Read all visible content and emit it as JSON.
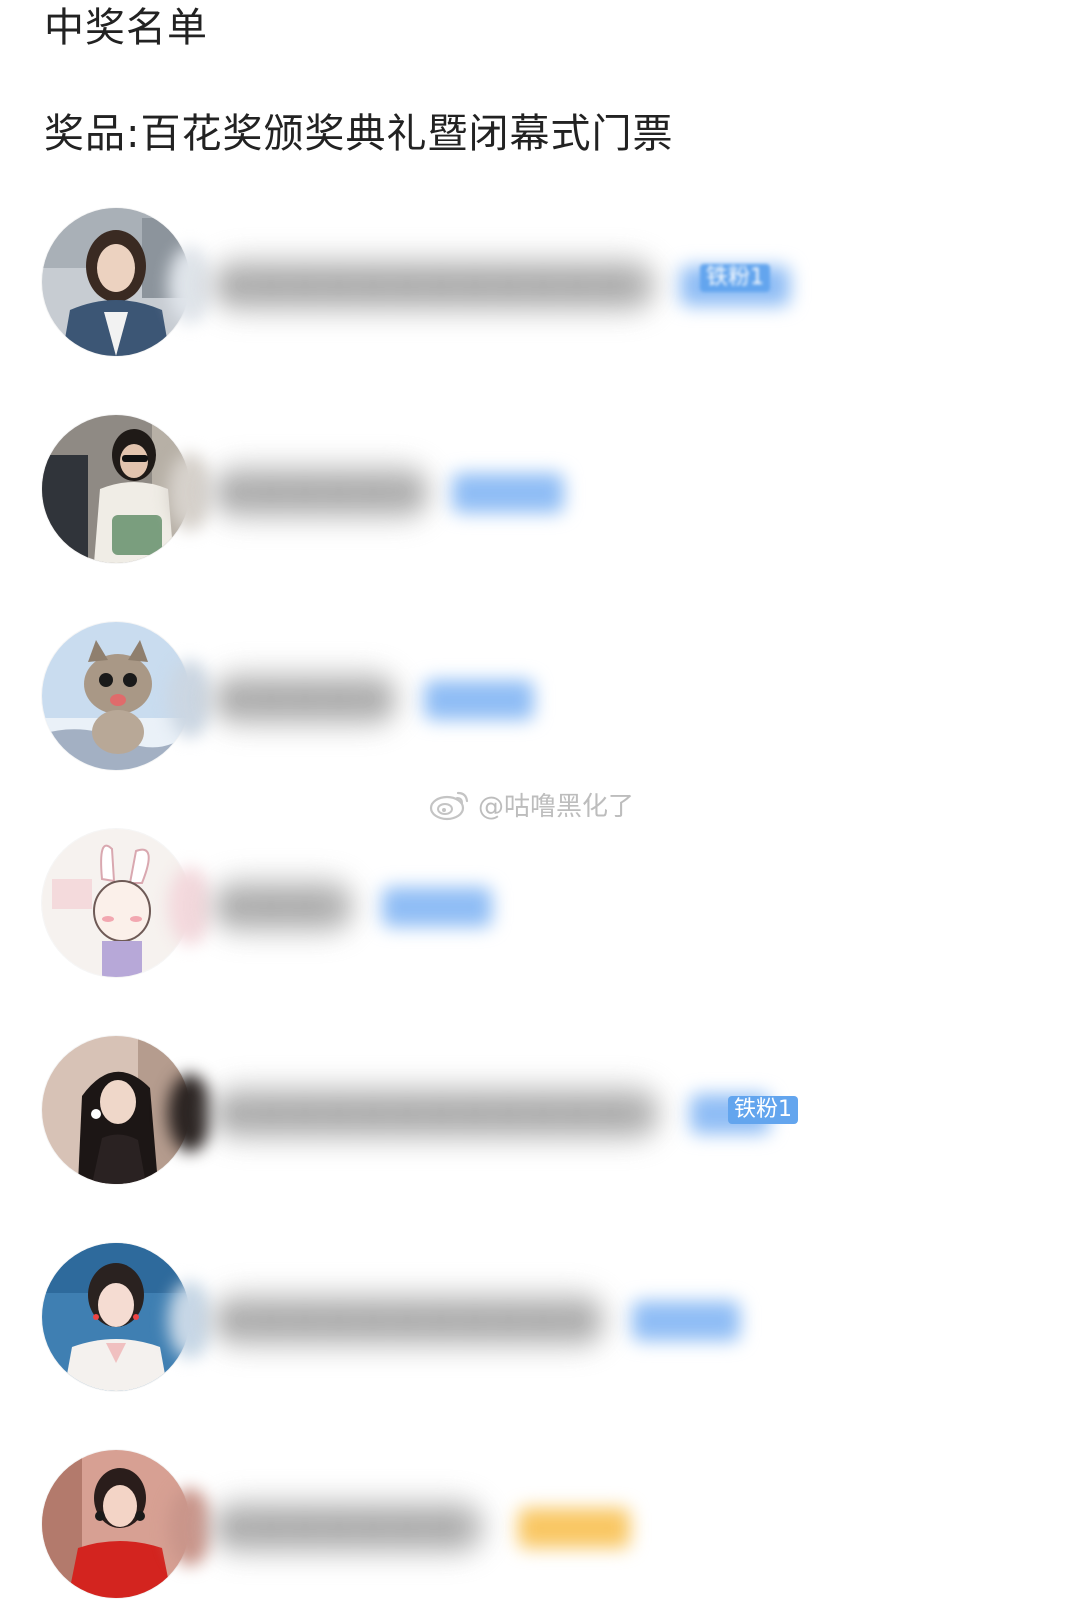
{
  "page": {
    "title": "中奖名单",
    "prize": "奖品:百花奖颁奖典礼暨闭幕式门票"
  },
  "watermark": {
    "text": "@咕噜黑化了",
    "icon": "weibo-logo-icon"
  },
  "winners": [
    {
      "avatar": "woman-denim-jacket-photo",
      "name": "",
      "badge_text": "铁粉1",
      "badge_color": "#63a5ee"
    },
    {
      "avatar": "woman-sunglasses-handbag-photo",
      "name": "",
      "badge_text": "",
      "badge_color": "#8fbdf5"
    },
    {
      "avatar": "leaping-kitten-photo",
      "name": "",
      "badge_text": "",
      "badge_color": "#8fbdf5"
    },
    {
      "avatar": "bunny-ear-girl-drawing",
      "name": "",
      "badge_text": "",
      "badge_color": "#8fbdf5"
    },
    {
      "avatar": "woman-long-hair-photo",
      "name": "",
      "badge_text": "铁粉1",
      "badge_color": "#63a5ee"
    },
    {
      "avatar": "woman-smiling-portrait-photo",
      "name": "",
      "badge_text": "",
      "badge_color": "#8fbdf5"
    },
    {
      "avatar": "woman-red-dress-photo",
      "name": "",
      "badge_text": "",
      "badge_color": "#f9c763"
    }
  ],
  "colors": {
    "text": "#222222",
    "badge_blue": "#63a5ee",
    "badge_gold": "#f9c763",
    "watermark": "#bdbdbd"
  }
}
